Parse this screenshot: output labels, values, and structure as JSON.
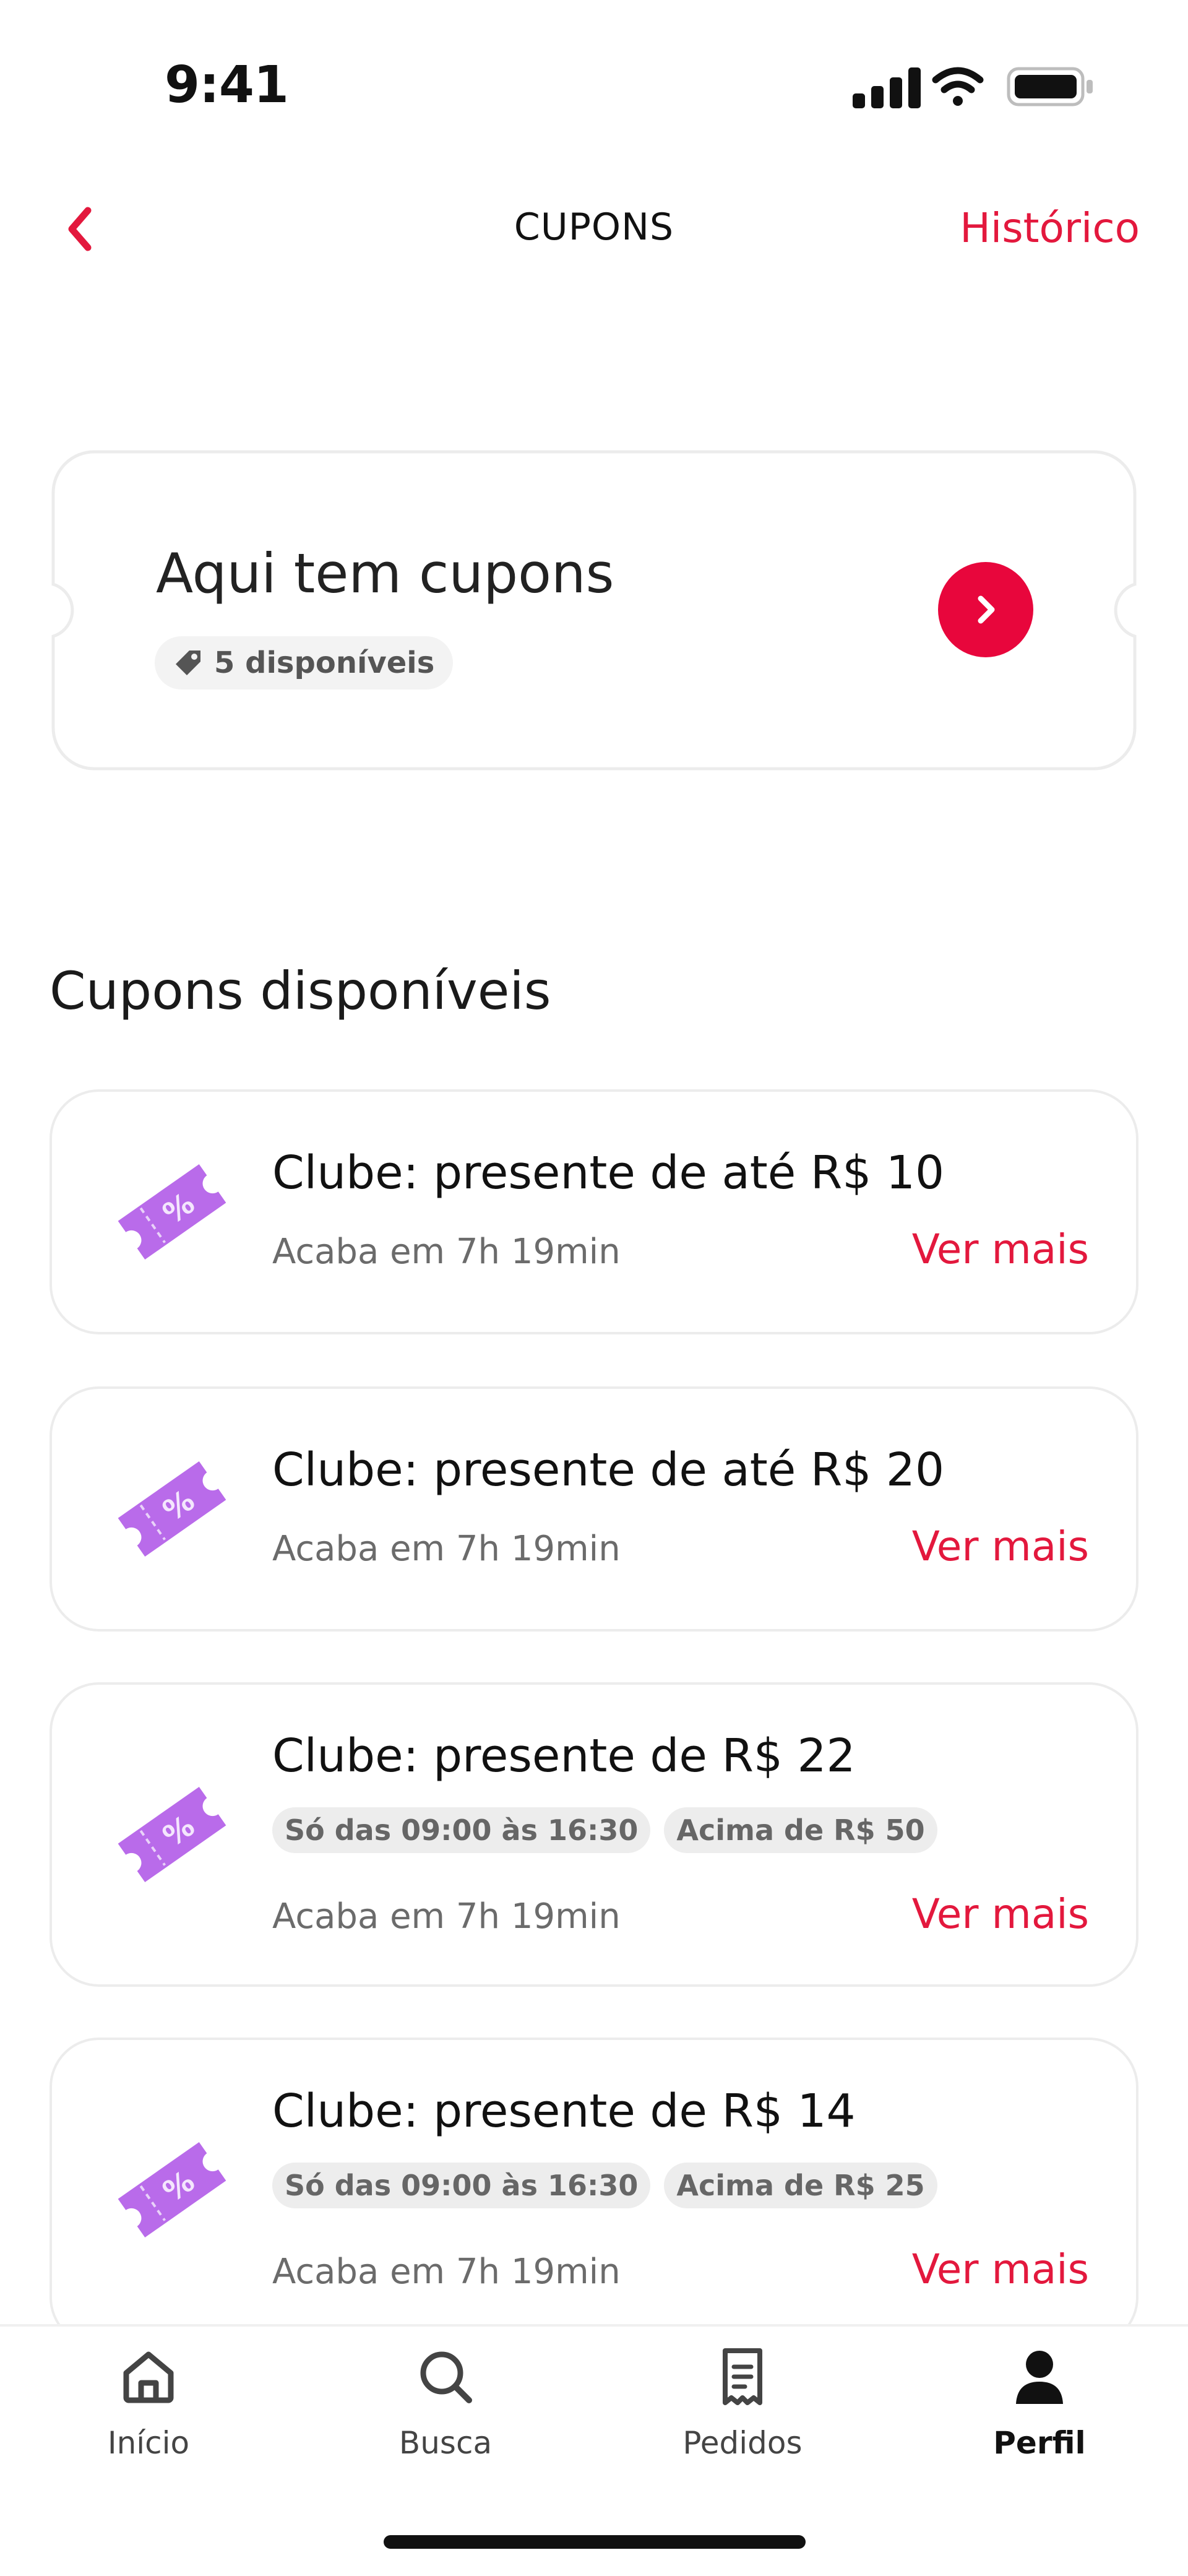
{
  "status_bar": {
    "time": "9:41"
  },
  "header": {
    "title": "CUPONS",
    "history_label": "Histórico",
    "accent_color": "#e3183d"
  },
  "banner": {
    "title": "Aqui tem cupons",
    "badge": "5 disponíveis"
  },
  "section": {
    "title": "Cupons disponíveis"
  },
  "coupons": [
    {
      "title": "Clube: presente de até R$ 10",
      "tags": [],
      "expiry": "Acaba em 7h 19min",
      "action": "Ver mais"
    },
    {
      "title": "Clube: presente de até R$ 20",
      "tags": [],
      "expiry": "Acaba em 7h 19min",
      "action": "Ver mais"
    },
    {
      "title": "Clube: presente de R$ 22",
      "tags": [
        "Só das 09:00 às 16:30",
        "Acima de R$ 50"
      ],
      "expiry": "Acaba em 7h 19min",
      "action": "Ver mais"
    },
    {
      "title": "Clube: presente de R$ 14",
      "tags": [
        "Só das 09:00 às 16:30",
        "Acima de R$ 25"
      ],
      "expiry": "Acaba em 7h 19min",
      "action": "Ver mais"
    }
  ],
  "bottom_nav": [
    {
      "label": "Início",
      "icon": "home-icon",
      "active": false
    },
    {
      "label": "Busca",
      "icon": "search-icon",
      "active": false
    },
    {
      "label": "Pedidos",
      "icon": "receipt-icon",
      "active": false
    },
    {
      "label": "Perfil",
      "icon": "profile-icon",
      "active": true
    }
  ]
}
